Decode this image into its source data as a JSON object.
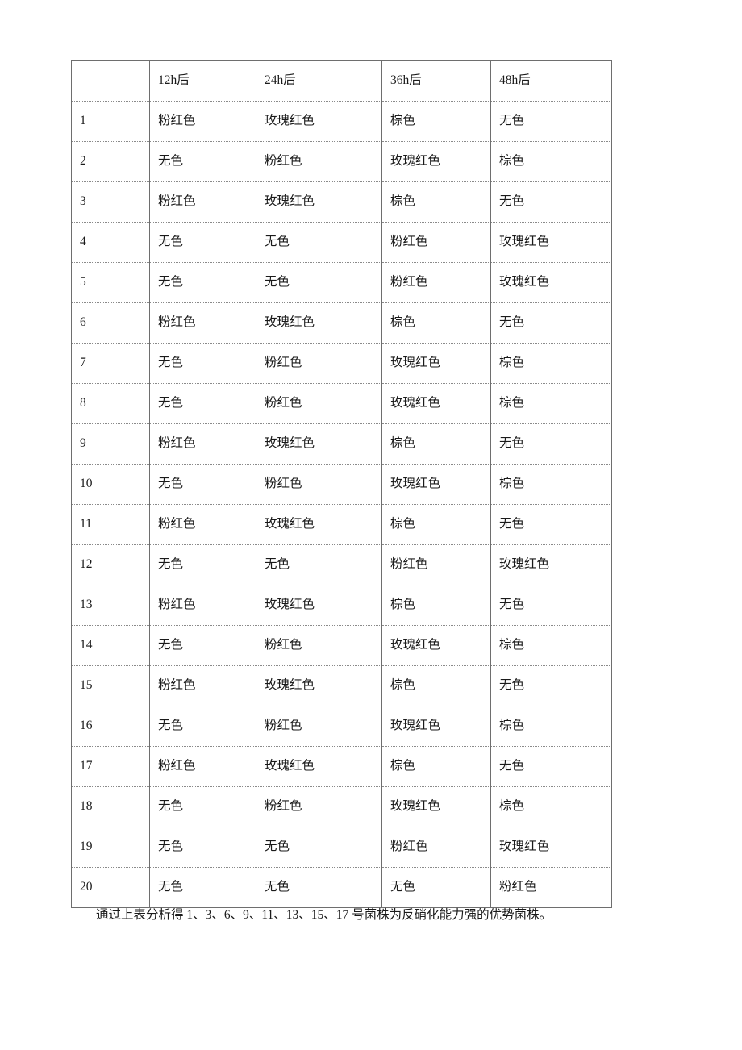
{
  "document": {
    "table": {
      "headers": [
        "",
        "12h后",
        "24h后",
        "36h后",
        "48h后"
      ],
      "rows": [
        {
          "index": "1",
          "h12": "粉红色",
          "h24": "玫瑰红色",
          "h36": "棕色",
          "h48": "无色"
        },
        {
          "index": "2",
          "h12": "无色",
          "h24": "粉红色",
          "h36": "玫瑰红色",
          "h48": "棕色"
        },
        {
          "index": "3",
          "h12": "粉红色",
          "h24": "玫瑰红色",
          "h36": "棕色",
          "h48": "无色"
        },
        {
          "index": "4",
          "h12": "无色",
          "h24": "无色",
          "h36": "粉红色",
          "h48": "玫瑰红色"
        },
        {
          "index": "5",
          "h12": "无色",
          "h24": "无色",
          "h36": "粉红色",
          "h48": "玫瑰红色"
        },
        {
          "index": "6",
          "h12": "粉红色",
          "h24": "玫瑰红色",
          "h36": "棕色",
          "h48": "无色"
        },
        {
          "index": "7",
          "h12": "无色",
          "h24": "粉红色",
          "h36": "玫瑰红色",
          "h48": "棕色"
        },
        {
          "index": "8",
          "h12": "无色",
          "h24": "粉红色",
          "h36": "玫瑰红色",
          "h48": "棕色"
        },
        {
          "index": "9",
          "h12": "粉红色",
          "h24": "玫瑰红色",
          "h36": "棕色",
          "h48": "无色"
        },
        {
          "index": "10",
          "h12": "无色",
          "h24": "粉红色",
          "h36": "玫瑰红色",
          "h48": "棕色"
        },
        {
          "index": "11",
          "h12": "粉红色",
          "h24": "玫瑰红色",
          "h36": "棕色",
          "h48": "无色"
        },
        {
          "index": "12",
          "h12": "无色",
          "h24": "无色",
          "h36": "粉红色",
          "h48": "玫瑰红色"
        },
        {
          "index": "13",
          "h12": "粉红色",
          "h24": "玫瑰红色",
          "h36": "棕色",
          "h48": "无色"
        },
        {
          "index": "14",
          "h12": "无色",
          "h24": "粉红色",
          "h36": "玫瑰红色",
          "h48": "棕色"
        },
        {
          "index": "15",
          "h12": "粉红色",
          "h24": "玫瑰红色",
          "h36": "棕色",
          "h48": "无色"
        },
        {
          "index": "16",
          "h12": "无色",
          "h24": "粉红色",
          "h36": "玫瑰红色",
          "h48": "棕色"
        },
        {
          "index": "17",
          "h12": "粉红色",
          "h24": "玫瑰红色",
          "h36": "棕色",
          "h48": "无色"
        },
        {
          "index": "18",
          "h12": "无色",
          "h24": "粉红色",
          "h36": "玫瑰红色",
          "h48": "棕色"
        },
        {
          "index": "19",
          "h12": "无色",
          "h24": "无色",
          "h36": "粉红色",
          "h48": "玫瑰红色"
        },
        {
          "index": "20",
          "h12": "无色",
          "h24": "无色",
          "h36": "无色",
          "h48": "粉红色"
        }
      ]
    },
    "caption": "通过上表分析得 1、3、6、9、11、13、15、17 号菌株为反硝化能力强的优势菌株。"
  }
}
